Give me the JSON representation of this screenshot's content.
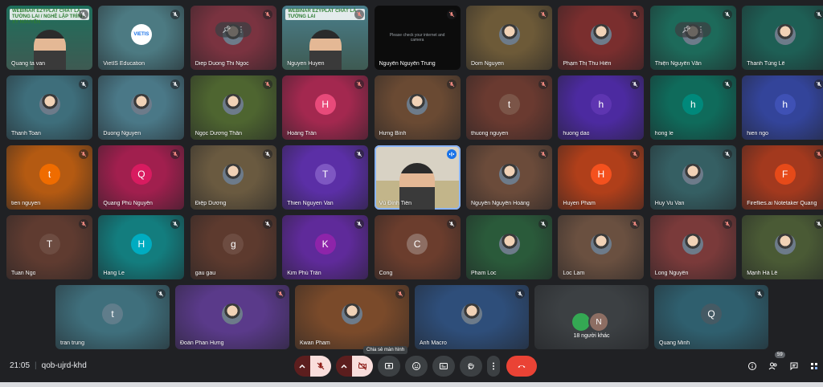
{
  "participants": [
    {
      "name": "Quang ta van",
      "color": "#1e6f5c",
      "mic": "on",
      "type": "video-banner",
      "banner": "WEBINAR EZYPLAT CHẤT LÀ TƯỜNG LAI / NGHỀ LẬP TRÌNH XY NGUYỄN"
    },
    {
      "name": "VietIS Education",
      "color": "#4c7a82",
      "mic": "on",
      "type": "logo",
      "logo": "VIETIS"
    },
    {
      "name": "Diep Duong Thi Ngoc",
      "color": "#7a3340",
      "mic": "muted",
      "type": "photo-hover"
    },
    {
      "name": "Nguyen Huyen",
      "color": "#4a7f8c",
      "mic": "muted",
      "type": "video-banner",
      "banner": "WEBINAR EZYPLAT CHẤT LÀ TƯỜNG LAI"
    },
    {
      "name": "Nguyễn Nguyễn Trung",
      "color": "#0c0c0c",
      "mic": "muted",
      "type": "dark",
      "subtext": "Please check your internet and camera"
    },
    {
      "name": "Dom Nguyen",
      "color": "#6d5a38",
      "mic": "muted",
      "type": "photo"
    },
    {
      "name": "Phạm Thị Thu Hiền",
      "color": "#7a2e2e",
      "mic": "muted",
      "type": "photo"
    },
    {
      "name": "Thiện Nguyễn Văn",
      "color": "#1d6a5a",
      "mic": "on",
      "type": "photo-hover"
    },
    {
      "name": "Thanh Tùng Lê",
      "color": "#1e5f55",
      "mic": "on",
      "type": "photo"
    },
    {
      "name": "Thanh Toan",
      "color": "#3e6e7b",
      "mic": "on",
      "type": "photo"
    },
    {
      "name": "Duong Nguyen",
      "color": "#4a7887",
      "mic": "on",
      "type": "photo"
    },
    {
      "name": "Ngọc Dương Thân",
      "color": "#4e6530",
      "mic": "muted",
      "type": "photo"
    },
    {
      "name": "Hoàng Trần",
      "color": "#a3284f",
      "mic": "muted",
      "type": "letter",
      "letter": "H",
      "avatarColor": "#e84a7a"
    },
    {
      "name": "Hưng Bình",
      "color": "#6a4a33",
      "mic": "muted",
      "type": "photo"
    },
    {
      "name": "thuong nguyen",
      "color": "#6a3a30",
      "mic": "muted",
      "type": "letter",
      "letter": "t",
      "avatarColor": "#7b5548"
    },
    {
      "name": "huong dao",
      "color": "#4c2aa0",
      "mic": "on",
      "type": "letter",
      "letter": "h",
      "avatarColor": "#5e35b1"
    },
    {
      "name": "hong le",
      "color": "#0f6b5b",
      "mic": "on",
      "type": "letter",
      "letter": "h",
      "avatarColor": "#00897b"
    },
    {
      "name": "hien ngo",
      "color": "#33449a",
      "mic": "on",
      "type": "letter",
      "letter": "h",
      "avatarColor": "#3f51b5"
    },
    {
      "name": "tien nguyen",
      "color": "#b45a12",
      "mic": "muted",
      "type": "letter",
      "letter": "t",
      "avatarColor": "#ef6c00"
    },
    {
      "name": "Quang Phú Nguyễn",
      "color": "#a11f4e",
      "mic": "muted",
      "type": "letter",
      "letter": "Q",
      "avatarColor": "#d81b60"
    },
    {
      "name": "Điệp Dương",
      "color": "#6a5a40",
      "mic": "on",
      "type": "photo"
    },
    {
      "name": "Thien Nguyen Van",
      "color": "#5b2fa6",
      "mic": "on",
      "type": "letter",
      "letter": "T",
      "avatarColor": "#7e57c2"
    },
    {
      "name": "Vũ Đình Tiến",
      "color": "#c9c3b4",
      "mic": "talking",
      "type": "live-video"
    },
    {
      "name": "Nguyễn Nguyễn Hoàng",
      "color": "#6b4b3a",
      "mic": "muted",
      "type": "photo"
    },
    {
      "name": "Huyen Pham",
      "color": "#b03f1a",
      "mic": "muted",
      "type": "letter",
      "letter": "H",
      "avatarColor": "#f4511e"
    },
    {
      "name": "Huy Vu Van",
      "color": "#355f63",
      "mic": "on",
      "type": "photo"
    },
    {
      "name": "Fireflies.ai Notetaker Quang",
      "color": "#a3391e",
      "mic": "muted",
      "type": "letter",
      "letter": "F",
      "avatarColor": "#e64a19"
    },
    {
      "name": "Tuan Ngo",
      "color": "#5f3b30",
      "mic": "muted",
      "type": "letter",
      "letter": "T",
      "avatarColor": "#6d4c41"
    },
    {
      "name": "Hang Le",
      "color": "#137d7e",
      "mic": "on",
      "type": "letter",
      "letter": "H",
      "avatarColor": "#00acc1"
    },
    {
      "name": "gau gau",
      "color": "#5d3a2e",
      "mic": "on",
      "type": "letter",
      "letter": "g",
      "avatarColor": "#6d4c41"
    },
    {
      "name": "Kim Phú Trần",
      "color": "#5f2a9a",
      "mic": "on",
      "type": "letter",
      "letter": "K",
      "avatarColor": "#8e24aa"
    },
    {
      "name": "Cong",
      "color": "#6b3d2d",
      "mic": "on",
      "type": "letter",
      "letter": "C",
      "avatarColor": "#8d6e63"
    },
    {
      "name": "Pham Loc",
      "color": "#2a5a3a",
      "mic": "on",
      "type": "photo"
    },
    {
      "name": "Loc Lam",
      "color": "#6a5040",
      "mic": "muted",
      "type": "photo"
    },
    {
      "name": "Long Nguyễn",
      "color": "#7a3a3a",
      "mic": "muted",
      "type": "photo"
    },
    {
      "name": "Mạnh Hà Lê",
      "color": "#4a5a35",
      "mic": "on",
      "type": "photo"
    },
    {
      "name": "tran trung",
      "color": "#3f6f7c",
      "mic": "on",
      "type": "letter",
      "letter": "t",
      "avatarColor": "#607d8b"
    },
    {
      "name": "Đoàn Phan Hưng",
      "color": "#5a3a8a",
      "mic": "muted",
      "type": "photo"
    },
    {
      "name": "Kwan Pham",
      "color": "#7a4a2a",
      "mic": "muted",
      "type": "photo"
    },
    {
      "name": "Anh Macro",
      "color": "#2e4e7a",
      "mic": "on",
      "type": "photo"
    },
    {
      "name": "18 người khác",
      "color": "#3c4043",
      "mic": "none",
      "type": "others",
      "others": [
        "",
        "N"
      ]
    },
    {
      "name": "Quang Minh",
      "color": "#2f5f6e",
      "mic": "on",
      "type": "letter",
      "letter": "Q",
      "avatarColor": "#455a64"
    }
  ],
  "footer": {
    "time": "21:05",
    "meeting_code": "qob-ujrd-khd",
    "tooltip": "Chia sẻ màn hình",
    "people_count": "59",
    "colors": {
      "muted_red": "#f28b82",
      "danger": "#ea4335",
      "button_gray": "#3c4043"
    }
  }
}
